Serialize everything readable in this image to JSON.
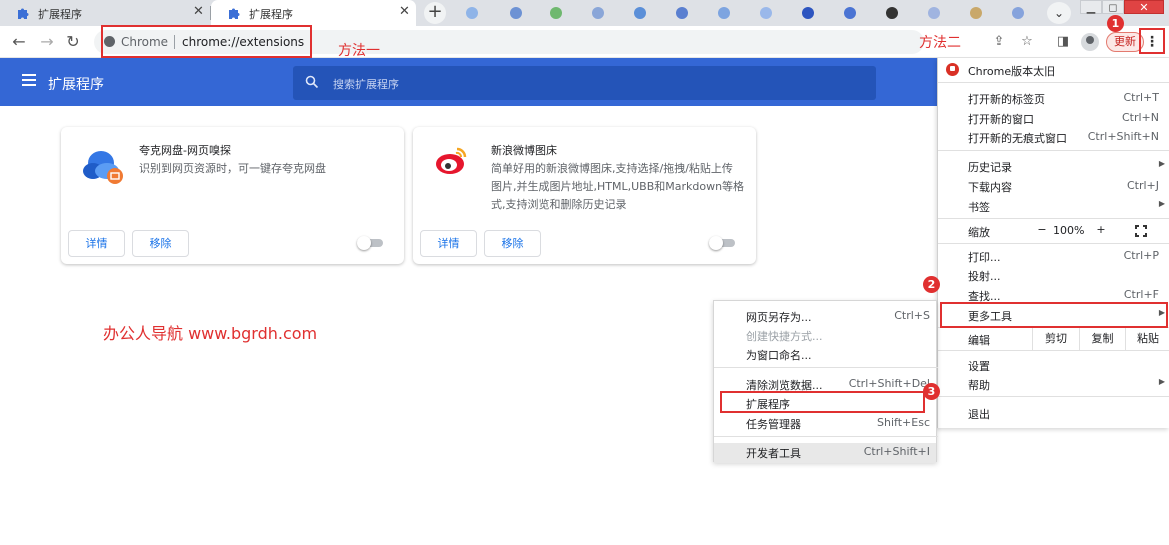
{
  "tabs": [
    {
      "title": "扩展程序",
      "active": false
    },
    {
      "title": "扩展程序",
      "active": true
    }
  ],
  "tab_icons": {
    "tab": "puzzle-icon",
    "new_tab": "plus-icon",
    "tab_search": "chevron-down-icon"
  },
  "window_controls": {
    "minimize": "▁",
    "maximize": "◻",
    "close": "✕"
  },
  "toolbar": {
    "back": "←",
    "forward": "→",
    "reload": "↻",
    "omnibox_prefix": "Chrome",
    "url": "chrome://extensions",
    "update_label": "更新",
    "menu_glyph": "⋮"
  },
  "annotations": {
    "method_one": "方法一",
    "method_two": "方法二",
    "step1": "1",
    "step2": "2",
    "step3": "3",
    "watermark": "办公人导航  www.bgrdh.com",
    "color": "#e03030"
  },
  "extensions_page": {
    "title": "扩展程序",
    "search_placeholder": "搜索扩展程序",
    "header_color": "#3467d5"
  },
  "extensions": [
    {
      "name": "夸克网盘-网页嗅探",
      "description_lines": [
        "识别到网页资源时，可一键存夸克网盘"
      ],
      "details_label": "详情",
      "remove_label": "移除",
      "enabled": false,
      "icon": "quark-cloud-icon"
    },
    {
      "name": "新浪微博图床",
      "description_lines": [
        "简单好用的新浪微博图床,支持选择/拖拽/粘贴上传",
        "图片,并生成图片地址,HTML,UBB和Markdown等格",
        "式,支持浏览和删除历史记录"
      ],
      "details_label": "详情",
      "remove_label": "移除",
      "enabled": false,
      "icon": "weibo-icon"
    }
  ],
  "chrome_menu": {
    "upgrade_notice": "Chrome版本太旧",
    "new_tab": {
      "label": "打开新的标签页",
      "shortcut": "Ctrl+T"
    },
    "new_window": {
      "label": "打开新的窗口",
      "shortcut": "Ctrl+N"
    },
    "new_incognito": {
      "label": "打开新的无痕式窗口",
      "shortcut": "Ctrl+Shift+N"
    },
    "history": {
      "label": "历史记录"
    },
    "downloads": {
      "label": "下载内容",
      "shortcut": "Ctrl+J"
    },
    "bookmarks": {
      "label": "书签"
    },
    "zoom": {
      "label": "缩放",
      "minus": "−",
      "value": "100%",
      "plus": "+"
    },
    "print": {
      "label": "打印...",
      "shortcut": "Ctrl+P"
    },
    "cast": {
      "label": "投射..."
    },
    "find": {
      "label": "查找...",
      "shortcut": "Ctrl+F"
    },
    "more_tools": {
      "label": "更多工具"
    },
    "edit": {
      "label": "编辑",
      "cut": "剪切",
      "copy": "复制",
      "paste": "粘贴"
    },
    "settings": {
      "label": "设置"
    },
    "help": {
      "label": "帮助"
    },
    "exit": {
      "label": "退出"
    }
  },
  "more_tools_menu": {
    "save_page": {
      "label": "网页另存为...",
      "shortcut": "Ctrl+S"
    },
    "create_shortcut": {
      "label": "创建快捷方式..."
    },
    "name_window": {
      "label": "为窗口命名..."
    },
    "clear_data": {
      "label": "清除浏览数据...",
      "shortcut": "Ctrl+Shift+Del"
    },
    "extensions": {
      "label": "扩展程序"
    },
    "task_manager": {
      "label": "任务管理器",
      "shortcut": "Shift+Esc"
    },
    "dev_tools": {
      "label": "开发者工具",
      "shortcut": "Ctrl+Shift+I"
    }
  }
}
